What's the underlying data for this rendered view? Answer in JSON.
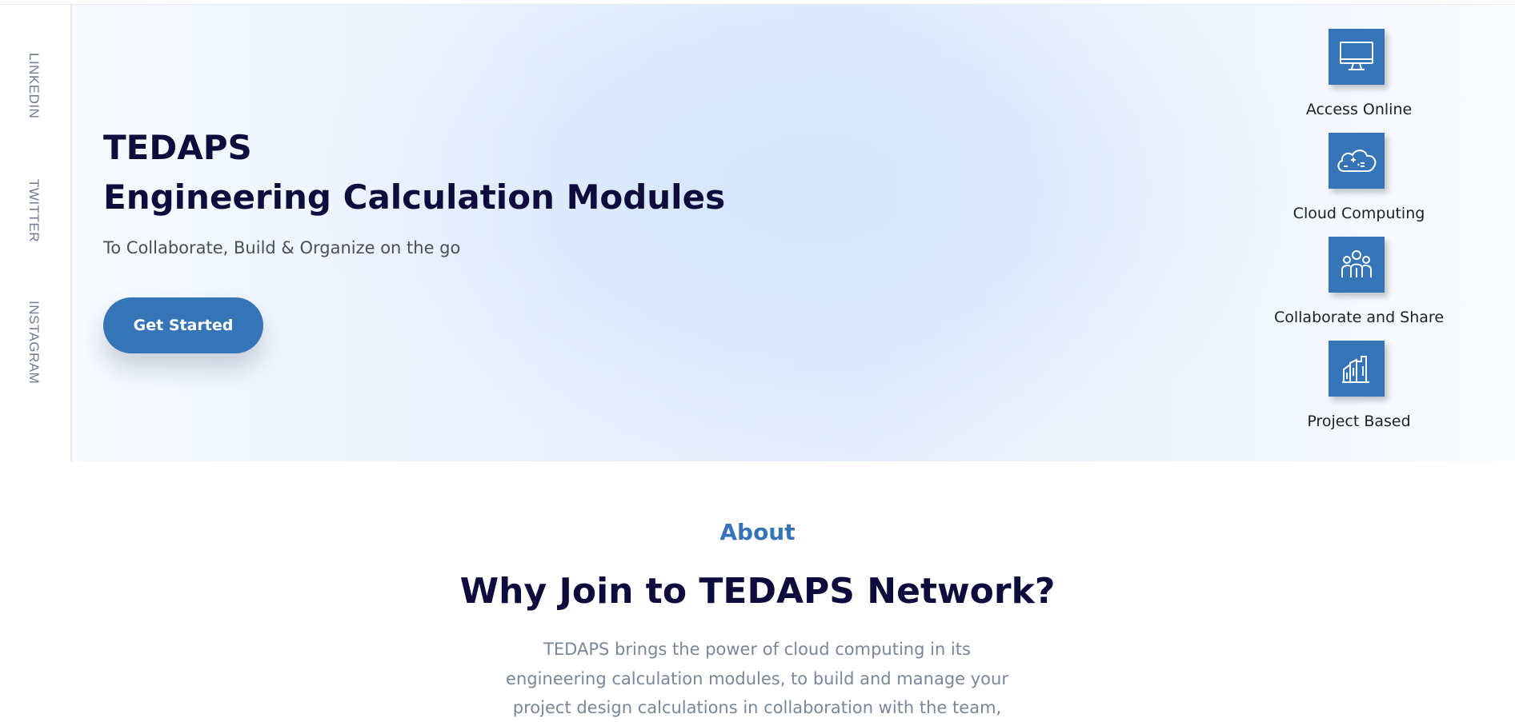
{
  "social": {
    "linkedin": "LINKEDIN",
    "twitter": "TWITTER",
    "instagram": "INSTAGRAM"
  },
  "hero": {
    "title_line1": "TEDAPS",
    "title_line2": "Engineering Calculation Modules",
    "subtitle": "To Collaborate, Build & Organize on the go",
    "cta_label": "Get Started"
  },
  "features": [
    {
      "icon": "monitor-icon",
      "label": "Access Online"
    },
    {
      "icon": "cloud-computing-icon",
      "label": "Cloud Computing"
    },
    {
      "icon": "team-icon",
      "label": "Collaborate and Share"
    },
    {
      "icon": "buildings-icon",
      "label": "Project Based"
    }
  ],
  "about": {
    "kicker": "About",
    "title": "Why Join to TEDAPS Network?",
    "text_lines": [
      "TEDAPS brings the power of cloud computing in its",
      "engineering calculation modules, to build and manage your",
      "project design calculations in collaboration with the team,"
    ]
  },
  "colors": {
    "accent": "#3574b7",
    "heading": "#0d0c3d",
    "body_text": "#7a869a"
  }
}
